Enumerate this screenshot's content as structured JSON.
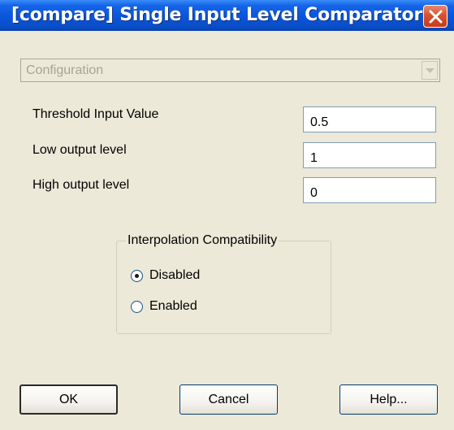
{
  "window": {
    "title": "[compare] Single Input Level Comparator"
  },
  "configuration": {
    "selected": "Configuration"
  },
  "fields": [
    {
      "label": "Threshold Input Value",
      "value": "0.5"
    },
    {
      "label": "Low output level",
      "value": "1"
    },
    {
      "label": "High output level",
      "value": "0"
    }
  ],
  "interpolation": {
    "legend": "Interpolation Compatibility",
    "options": [
      {
        "label": "Disabled",
        "selected": true
      },
      {
        "label": "Enabled",
        "selected": false
      }
    ]
  },
  "buttons": {
    "ok": "OK",
    "cancel": "Cancel",
    "help": "Help..."
  },
  "colors": {
    "titlebar": "#0a55d9",
    "dialog_bg": "#ece9d8",
    "close_button": "#d8522f"
  },
  "icons": {
    "close": "close-icon",
    "dropdown": "chevron-down-icon"
  }
}
